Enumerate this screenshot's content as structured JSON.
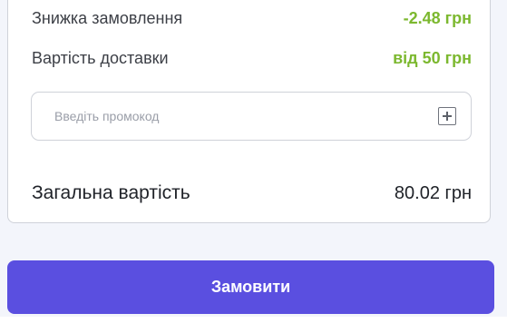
{
  "summary": {
    "discount": {
      "label": "Знижка замовлення",
      "value": "-2.48 грн"
    },
    "delivery": {
      "label": "Вартість доставки",
      "value": "від 50 грн"
    },
    "promo": {
      "placeholder": "Введіть промокод",
      "value": "",
      "add_icon": "plus-square-icon"
    },
    "total": {
      "label": "Загальна вартість",
      "value": "80.02 грн"
    }
  },
  "actions": {
    "order_label": "Замовити"
  },
  "colors": {
    "accent": "#5a4fe0",
    "highlight_green": "#7cb82f"
  }
}
